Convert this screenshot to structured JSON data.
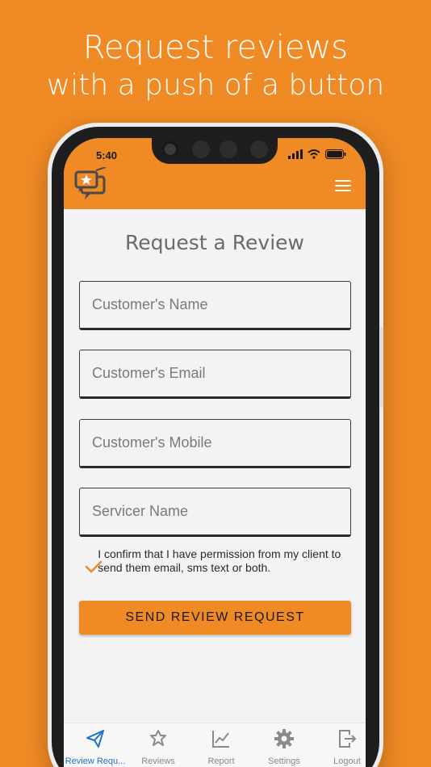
{
  "headline": {
    "line1": "Request reviews",
    "line2": "with a push of a button"
  },
  "status_bar": {
    "time": "5:40"
  },
  "header": {
    "logo_icon": "chat-bubbles-star-logo",
    "menu_icon": "hamburger-menu-icon"
  },
  "form": {
    "title": "Request a Review",
    "fields": [
      {
        "placeholder": "Customer's Name"
      },
      {
        "placeholder": "Customer's Email"
      },
      {
        "placeholder": "Customer's Mobile"
      },
      {
        "placeholder": "Servicer Name"
      }
    ],
    "confirm_checked": true,
    "confirm_text": "I confirm that I have permission from my client to send them email, sms text or both.",
    "submit_label": "SEND REVIEW REQUEST"
  },
  "tabbar": {
    "items": [
      {
        "label": "Review Requ...",
        "icon": "paper-plane-icon",
        "active": true
      },
      {
        "label": "Reviews",
        "icon": "star-outline-icon",
        "active": false
      },
      {
        "label": "Report",
        "icon": "line-chart-icon",
        "active": false
      },
      {
        "label": "Settings",
        "icon": "gear-icon",
        "active": false
      },
      {
        "label": "Logout",
        "icon": "logout-icon",
        "active": false
      }
    ]
  },
  "colors": {
    "brand_orange": "#f08a24",
    "active_tab": "#1e73c8",
    "check_orange": "#f08a24"
  }
}
